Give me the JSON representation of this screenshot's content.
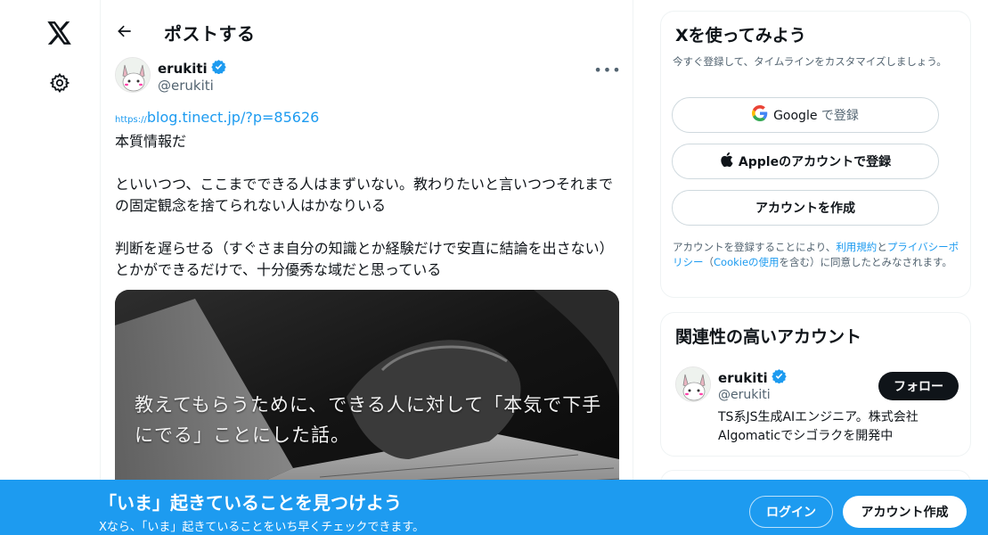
{
  "nav": {
    "logo_icon": "x-logo-icon",
    "settings_icon": "gear-icon"
  },
  "header": {
    "title": "ポストする"
  },
  "post": {
    "author_name": "erukiti",
    "author_handle": "@erukiti",
    "verified": true,
    "link_proto": "https://",
    "link_text": "blog.tinect.jp/?p=85626",
    "para1": "本質情報だ",
    "para2": "といいつつ、ここまでできる人はまずいない。教わりたいと言いつつそれまでの固定観念を捨てられない人はかなりいる",
    "para3": "判断を遅らせる（すぐさま自分の知識とか経験だけで安直に結論を出さない）とかができるだけで、十分優秀な域だと思っている",
    "media_caption": "教えてもらうために、できる人に対して「本気で下手にでる」ことにした話。"
  },
  "signup_card": {
    "title": "Xを使ってみよう",
    "subtitle": "今すぐ登録して、タイムラインをカスタマイズしましょう。",
    "google_brand": "Google",
    "google_suffix": "で登録",
    "apple_label": "Appleのアカウントで登録",
    "create_label": "アカウントを作成",
    "terms_prefix": "アカウントを登録することにより、",
    "terms_link1": "利用規約",
    "terms_and": "と",
    "terms_link2": "プライバシーポリシー",
    "terms_open": "（",
    "terms_link3": "Cookieの使用",
    "terms_suffix": "を含む）に同意したとみなされます。"
  },
  "related_card": {
    "title": "関連性の高いアカウント",
    "name": "erukiti",
    "handle": "@erukiti",
    "bio": "TS系JS生成AIエンジニア。株式会社Algomaticでシゴラクを開発中",
    "follow_label": "フォロー"
  },
  "banner": {
    "title": "「いま」起きていることを見つけよう",
    "subtitle": "Xなら、「いま」起きていることをいち早くチェックできます。",
    "login_label": "ログイン",
    "signup_label": "アカウント作成"
  },
  "colors": {
    "accent": "#1d9bf0",
    "text": "#0f1419",
    "muted": "#536471"
  }
}
